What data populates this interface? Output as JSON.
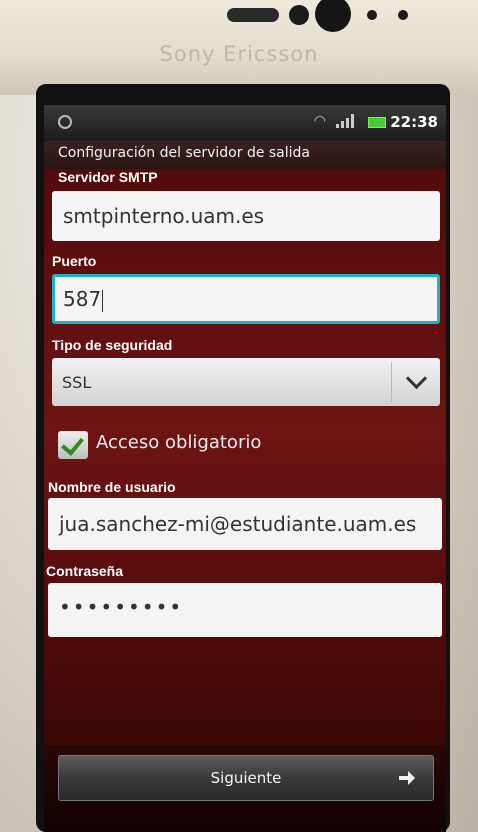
{
  "device": {
    "brand": "Sony Ericsson"
  },
  "status_bar": {
    "time": "22:38"
  },
  "screen": {
    "title": "Configuración del servidor de salida",
    "smtp": {
      "label": "Servidor SMTP",
      "value": "smtpinterno.uam.es"
    },
    "port": {
      "label": "Puerto",
      "value": "587"
    },
    "security": {
      "label": "Tipo de seguridad",
      "value": "SSL"
    },
    "auth": {
      "label": "Acceso obligatorio",
      "checked": true
    },
    "username": {
      "label": "Nombre de usuario",
      "value": "jua.sanchez-mi@estudiante.uam.es"
    },
    "password": {
      "label": "Contraseña",
      "value": "•••••••••"
    },
    "next_button": {
      "label": "Siguiente"
    }
  },
  "colors": {
    "accent_focus": "#1fb3c7",
    "check_green": "#2e8b1c",
    "background": "#5c0d0d"
  },
  "icons": [
    "notification-icon",
    "wifi-icon",
    "signal-icon",
    "battery-icon",
    "chevron-down-icon",
    "checkmark-icon",
    "arrow-right-icon"
  ]
}
